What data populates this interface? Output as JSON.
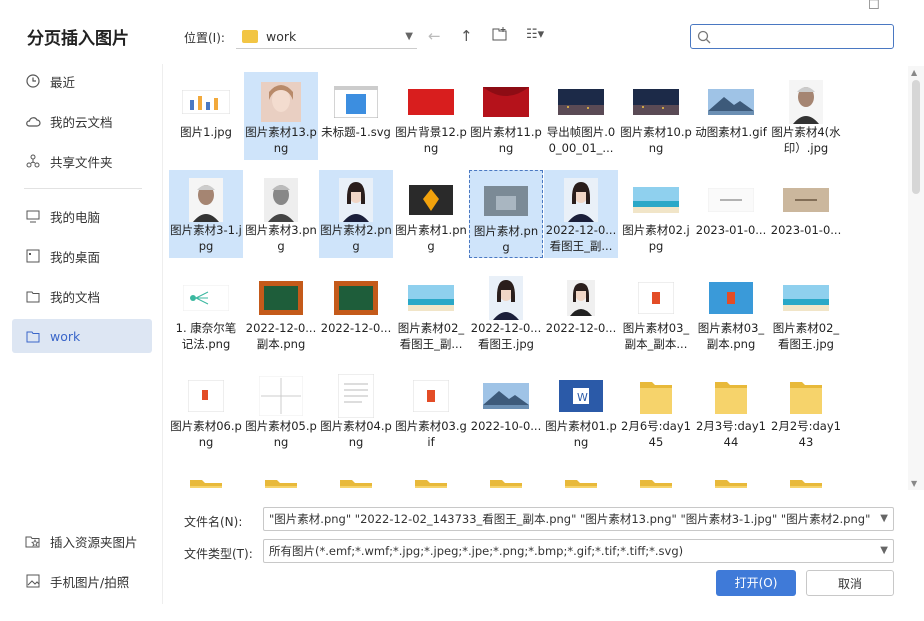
{
  "dialog": {
    "title": "分页插入图片"
  },
  "sidebar": {
    "items": [
      {
        "label": "最近",
        "icon": "clock-icon"
      },
      {
        "label": "我的云文档",
        "icon": "cloud-icon"
      },
      {
        "label": "共享文件夹",
        "icon": "share-icon"
      },
      {
        "label": "我的电脑",
        "icon": "computer-icon"
      },
      {
        "label": "我的桌面",
        "icon": "desktop-icon"
      },
      {
        "label": "我的文档",
        "icon": "document-icon"
      },
      {
        "label": "work",
        "icon": "folder-icon"
      }
    ],
    "bottom": [
      {
        "label": "插入资源夹图片",
        "icon": "star-folder-icon"
      },
      {
        "label": "手机图片/拍照",
        "icon": "image-icon"
      }
    ]
  },
  "toolbar": {
    "location_label": "位置(I):",
    "location_value": "work",
    "search_placeholder": ""
  },
  "files": [
    {
      "name": "图片1.jpg",
      "kind": "chart",
      "selected": false
    },
    {
      "name": "图片素材13.png",
      "kind": "face",
      "selected": true
    },
    {
      "name": "未标题-1.svg",
      "kind": "window",
      "selected": false
    },
    {
      "name": "图片背景12.png",
      "kind": "red",
      "selected": false
    },
    {
      "name": "图片素材11.png",
      "kind": "curtain",
      "selected": false
    },
    {
      "name": "导出帧图片.00_00_01_...",
      "kind": "city",
      "selected": false
    },
    {
      "name": "图片素材10.png",
      "kind": "city",
      "selected": false
    },
    {
      "name": "动图素材1.gif",
      "kind": "mountain",
      "selected": false
    },
    {
      "name": "图片素材4(水印）.jpg",
      "kind": "portrait",
      "selected": false
    },
    {
      "name": "图片素材3-1.jpg",
      "kind": "portrait",
      "selected": true
    },
    {
      "name": "图片素材3.png",
      "kind": "portrait-gray",
      "selected": false
    },
    {
      "name": "图片素材2.png",
      "kind": "woman",
      "selected": true
    },
    {
      "name": "图片素材1.png",
      "kind": "leaf",
      "selected": false
    },
    {
      "name": "图片素材.png",
      "kind": "photo",
      "selected": true
    },
    {
      "name": "2022-12-0...看图王_副...",
      "kind": "woman",
      "selected": true
    },
    {
      "name": "图片素材02.jpg",
      "kind": "beach",
      "selected": false
    },
    {
      "name": "2023-01-0...",
      "kind": "text-light",
      "selected": false
    },
    {
      "name": "2023-01-0...",
      "kind": "text-tan",
      "selected": false
    },
    {
      "name": "1. 康奈尔笔记法.png",
      "kind": "mindmap",
      "selected": false
    },
    {
      "name": "2022-12-0...副本.png",
      "kind": "board",
      "selected": false
    },
    {
      "name": "2022-12-0...",
      "kind": "board",
      "selected": false
    },
    {
      "name": "图片素材02_看图王_副...",
      "kind": "beach",
      "selected": false
    },
    {
      "name": "2022-12-0...看图王.jpg",
      "kind": "woman",
      "selected": false
    },
    {
      "name": "2022-12-0...",
      "kind": "woman-small",
      "selected": false
    },
    {
      "name": "图片素材03_副本_副本...",
      "kind": "office",
      "selected": false
    },
    {
      "name": "图片素材03_副本.png",
      "kind": "office-blue",
      "selected": false
    },
    {
      "name": "图片素材02_看图王.jpg",
      "kind": "beach",
      "selected": false
    },
    {
      "name": "图片素材06.png",
      "kind": "office-small",
      "selected": false
    },
    {
      "name": "图片素材05.png",
      "kind": "sketch",
      "selected": false
    },
    {
      "name": "图片素材04.png",
      "kind": "doc",
      "selected": false
    },
    {
      "name": "图片素材03.gif",
      "kind": "office",
      "selected": false
    },
    {
      "name": "2022-10-0...",
      "kind": "mountain",
      "selected": false
    },
    {
      "name": "图片素材01.png",
      "kind": "word",
      "selected": false
    },
    {
      "name": "2月6号:day145",
      "kind": "folder",
      "selected": false
    },
    {
      "name": "2月3号:day144",
      "kind": "folder",
      "selected": false
    },
    {
      "name": "2月2号:day143",
      "kind": "folder",
      "selected": false
    },
    {
      "name": "",
      "kind": "folder",
      "selected": false
    },
    {
      "name": "",
      "kind": "folder",
      "selected": false
    },
    {
      "name": "",
      "kind": "folder",
      "selected": false
    },
    {
      "name": "",
      "kind": "folder",
      "selected": false
    },
    {
      "name": "",
      "kind": "folder",
      "selected": false
    },
    {
      "name": "",
      "kind": "folder",
      "selected": false
    },
    {
      "name": "",
      "kind": "folder",
      "selected": false
    },
    {
      "name": "",
      "kind": "folder",
      "selected": false
    },
    {
      "name": "",
      "kind": "folder",
      "selected": false
    }
  ],
  "footer": {
    "filename_label": "文件名(N):",
    "filename_value": "\"图片素材.png\" \"2022-12-02_143733_看图王_副本.png\" \"图片素材13.png\" \"图片素材3-1.jpg\" \"图片素材2.png\"",
    "filetype_label": "文件类型(T):",
    "filetype_value": "所有图片(*.emf;*.wmf;*.jpg;*.jpeg;*.jpe;*.png;*.bmp;*.gif;*.tif;*.tiff;*.svg)",
    "open_label": "打开(O)",
    "cancel_label": "取消"
  },
  "colors": {
    "accent": "#3f7ad8",
    "selected": "#cfe4fa",
    "folder": "#f2c544"
  }
}
